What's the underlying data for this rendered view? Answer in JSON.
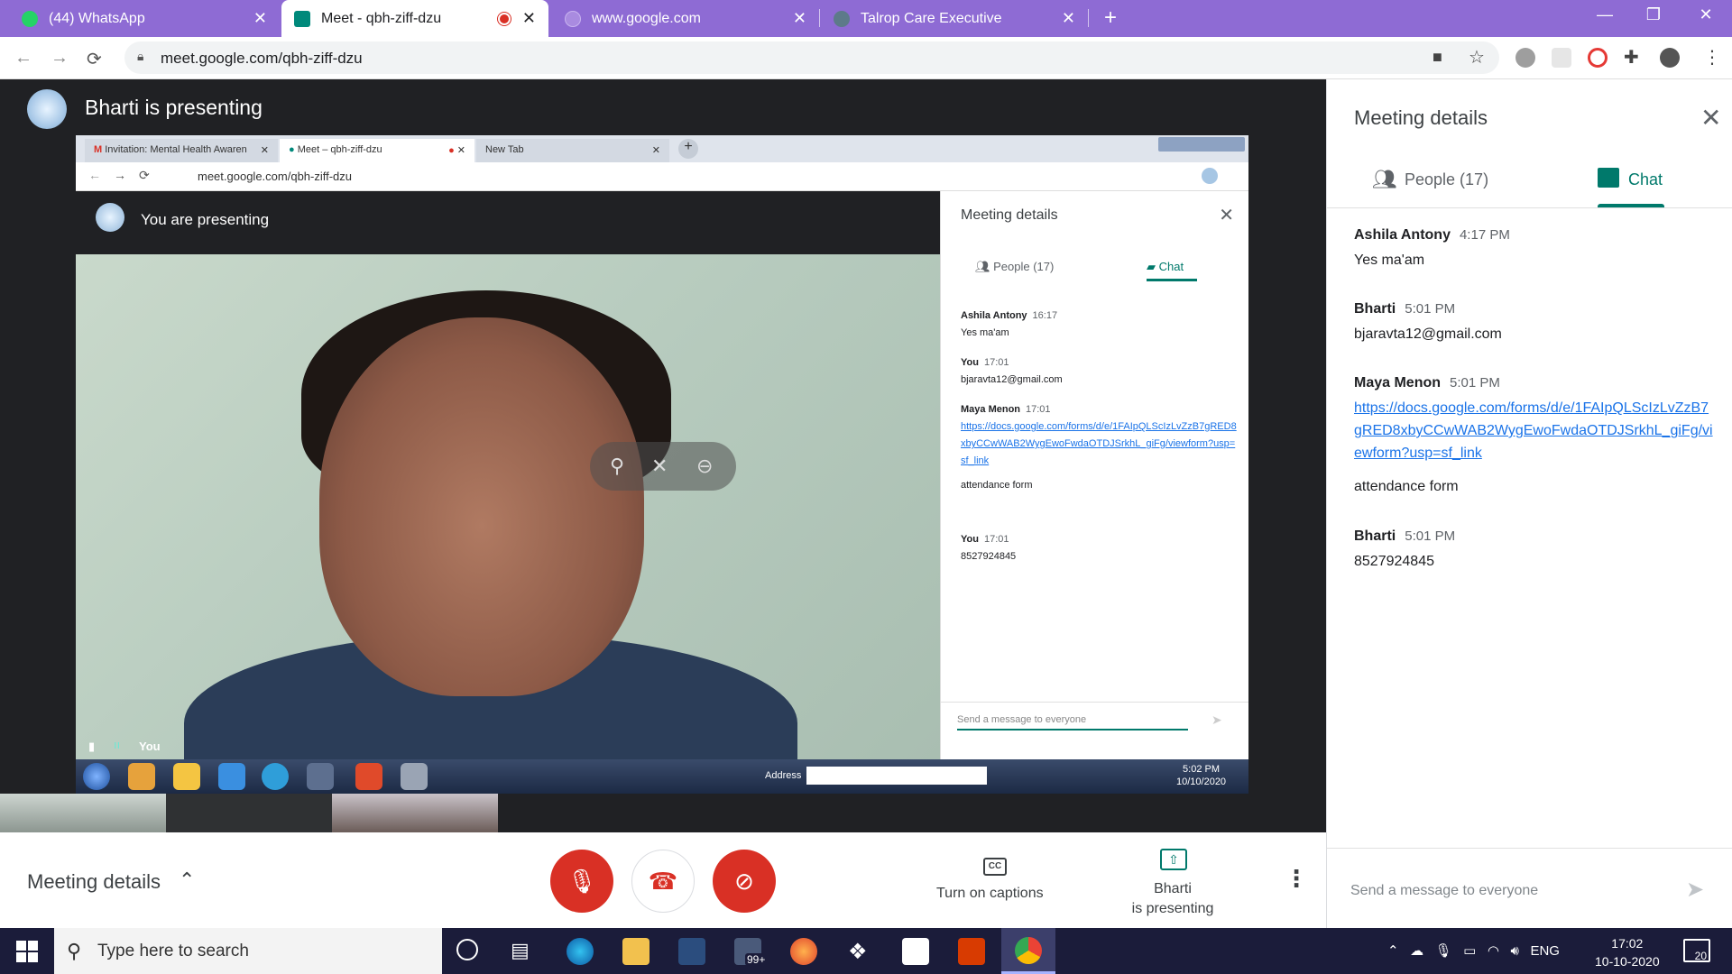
{
  "browser": {
    "tabs": [
      {
        "title": "(44) WhatsApp",
        "favicon": "whatsapp-icon",
        "active": false
      },
      {
        "title": "Meet - qbh-ziff-dzu",
        "favicon": "meet-icon",
        "active": true,
        "recording": true
      },
      {
        "title": "www.google.com",
        "favicon": "google-icon",
        "active": false
      },
      {
        "title": "Talrop Care Executive",
        "favicon": "talrop-icon",
        "active": false
      }
    ],
    "new_tab": "+",
    "url": "meet.google.com/qbh-ziff-dzu",
    "accent": "#8e6bd4"
  },
  "stage": {
    "presenter_title": "Bharti is presenting",
    "shared_screen": {
      "tabs": [
        {
          "title": "Invitation: Mental Health Awaren"
        },
        {
          "title": "Meet – qbh-ziff-dzu"
        },
        {
          "title": "New Tab"
        }
      ],
      "url": "meet.google.com/qbh-ziff-dzu",
      "presenting_title": "You are presenting",
      "you_label": "You",
      "panel": {
        "title": "Meeting details",
        "people_tab": "People (17)",
        "chat_tab": "Chat",
        "messages": [
          {
            "name": "Ashila Antony",
            "time": "16:17",
            "lines": [
              "Yes ma'am"
            ]
          },
          {
            "name": "You",
            "time": "17:01",
            "lines": [
              "bjaravta12@gmail.com"
            ]
          },
          {
            "name": "Maya Menon",
            "time": "17:01",
            "link": "https://docs.google.com/forms/d/e/1FAIpQLScIzLvZzB7gRED8xbyCCwWAB2WygEwoFwdaOTDJSrkhL_giFg/viewform?usp=sf_link",
            "lines": [
              "attendance form"
            ]
          },
          {
            "name": "You",
            "time": "17:01",
            "lines": [
              "8527924845"
            ]
          }
        ],
        "send_placeholder": "Send a message to everyone"
      },
      "taskbar": {
        "address_label": "Address",
        "time": "5:02 PM",
        "date": "10/10/2020"
      }
    }
  },
  "controls": {
    "meeting_details": "Meeting details",
    "captions": "Turn on captions",
    "present_line1": "Bharti",
    "present_line2": "is presenting",
    "accent_red": "#d93025",
    "accent_teal": "#00796b"
  },
  "side_panel": {
    "title": "Meeting details",
    "people_tab": "People (17)",
    "chat_tab": "Chat",
    "messages": [
      {
        "name": "Ashila Antony",
        "time": "4:17 PM",
        "body": "Yes ma'am"
      },
      {
        "name": "Bharti",
        "time": "5:01 PM",
        "body": "bjaravta12@gmail.com"
      },
      {
        "name": "Maya Menon",
        "time": "5:01 PM",
        "link": "https://docs.google.com/forms/d/e/1FAIpQLScIzLvZzB7gRED8xbyCCwWAB2WygEwoFwdaOTDJSrkhL_giFg/viewform?usp=sf_link",
        "body": "attendance form"
      },
      {
        "name": "Bharti",
        "time": "5:01 PM",
        "body": "8527924845"
      }
    ],
    "send_placeholder": "Send a message to everyone"
  },
  "taskbar": {
    "search_placeholder": "Type here to search",
    "store_badge": "99+",
    "language": "ENG",
    "time": "17:02",
    "date": "10-10-2020",
    "notifications": "20"
  }
}
